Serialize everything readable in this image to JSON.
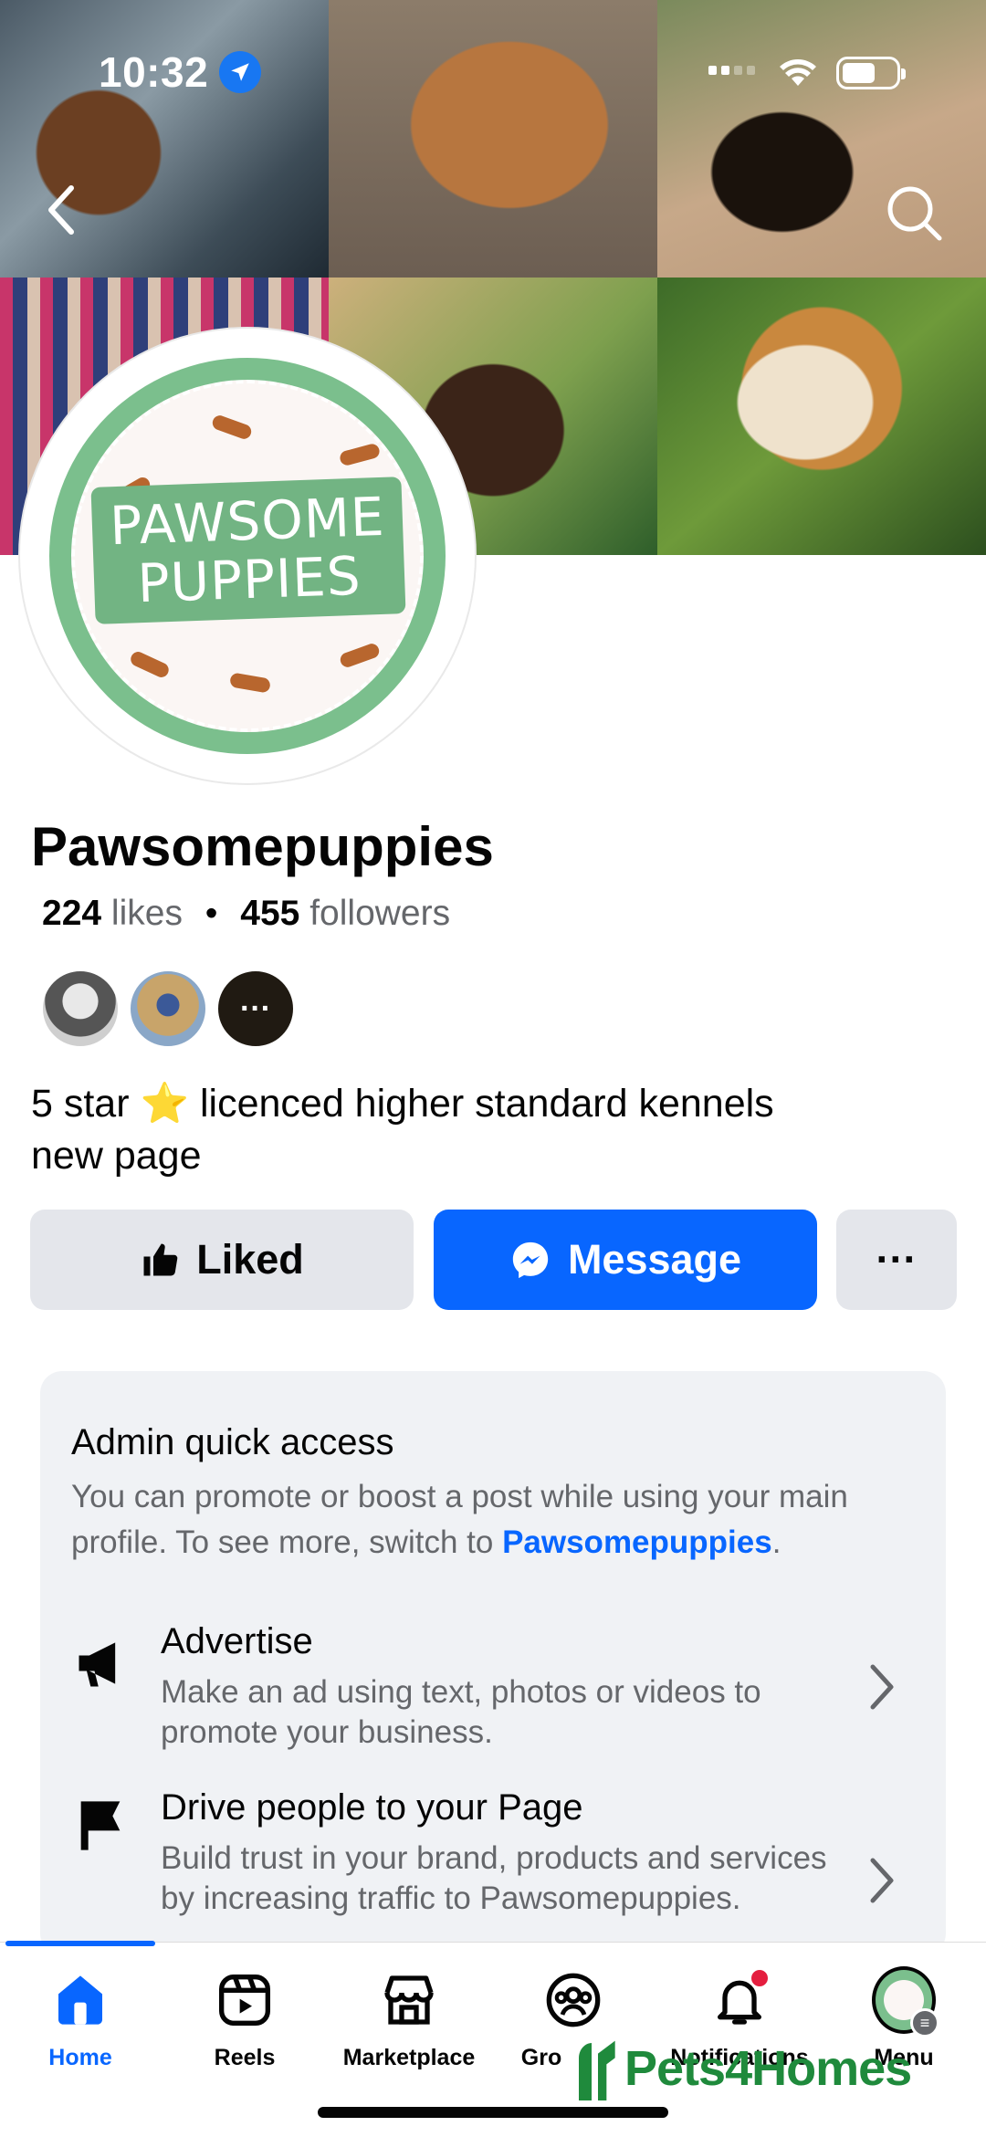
{
  "status_bar": {
    "time": "10:32"
  },
  "page": {
    "name": "Pawsomepuppies",
    "likes_count": "224",
    "likes_label": "likes",
    "separator": "•",
    "followers_count": "455",
    "followers_label": "followers",
    "more_friends": "···",
    "bio_line1": "5 star ⭐️ licenced higher standard kennels",
    "bio_line2": "new page",
    "avatar_text_line1": "PAWSOME",
    "avatar_text_line2": "PUPPIES"
  },
  "actions": {
    "liked": "Liked",
    "message": "Message",
    "more": "···"
  },
  "admin": {
    "title": "Admin quick access",
    "desc_before": "You can promote or boost a post while using your main profile. To see more, switch to ",
    "desc_link": "Pawsomepuppies",
    "desc_after": ".",
    "options": [
      {
        "title": "Advertise",
        "desc": "Make an ad using text, photos or videos to promote your business."
      },
      {
        "title": "Drive people to your Page",
        "desc": "Build trust in your brand, products and services by increasing traffic to Pawsomepuppies."
      }
    ]
  },
  "nav": {
    "items": [
      {
        "label": "Home"
      },
      {
        "label": "Reels"
      },
      {
        "label": "Marketplace"
      },
      {
        "label": "Gro"
      },
      {
        "label": "Notifications"
      },
      {
        "label": "Menu"
      }
    ]
  },
  "watermark": "Pets4Homes",
  "colors": {
    "accent": "#0866ff",
    "button_grey": "#e4e6eb",
    "card_bg": "#f0f2f5",
    "notif": "#e41e3f",
    "watermark": "#1f8a3c"
  },
  "icons": [
    "location-arrow-icon",
    "back-icon",
    "search-icon",
    "thumbs-up-icon",
    "messenger-icon",
    "megaphone-icon",
    "flag-icon",
    "chevron-right-icon",
    "home-icon",
    "reels-icon",
    "marketplace-icon",
    "groups-icon",
    "bell-icon"
  ]
}
